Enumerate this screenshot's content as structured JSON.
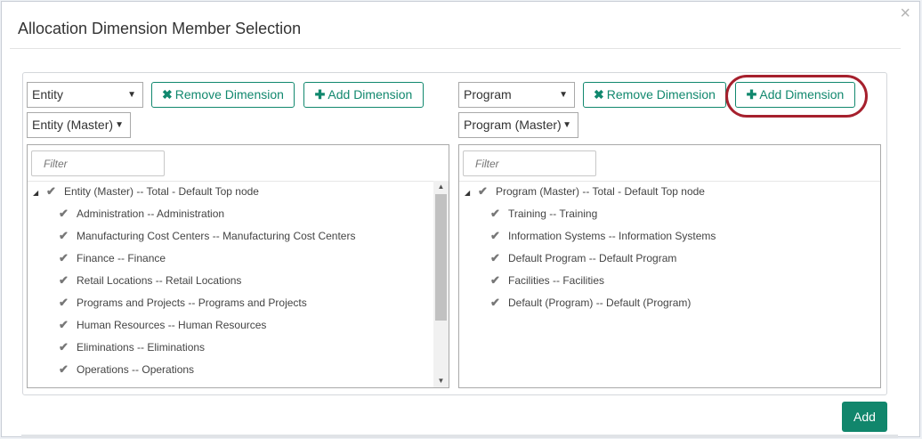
{
  "dialog": {
    "title": "Allocation Dimension Member Selection",
    "close_glyph": "×",
    "add_label": "Add"
  },
  "left": {
    "dimension_select": "Entity",
    "hierarchy_select": "Entity (Master)",
    "remove_label": "Remove Dimension",
    "add_label": "Add Dimension",
    "filter_placeholder": "Filter",
    "root": "Entity (Master) -- Total - Default Top node",
    "items": [
      "Administration -- Administration",
      "Manufacturing Cost Centers -- Manufacturing Cost Centers",
      "Finance -- Finance",
      "Retail Locations -- Retail Locations",
      "Programs and Projects -- Programs and Projects",
      "Human Resources -- Human Resources",
      "Eliminations -- Eliminations",
      "Operations -- Operations"
    ]
  },
  "right": {
    "dimension_select": "Program",
    "hierarchy_select": "Program (Master)",
    "remove_label": "Remove Dimension",
    "add_label": "Add Dimension",
    "filter_placeholder": "Filter",
    "root": "Program (Master) -- Total - Default Top node",
    "items": [
      "Training -- Training",
      "Information Systems -- Information Systems",
      "Default Program -- Default Program",
      "Facilities -- Facilities",
      "Default (Program) -- Default (Program)"
    ]
  },
  "colors": {
    "accent": "#11866c",
    "highlight_ring": "#a6202d",
    "checkmark": "#777777"
  },
  "icons": {
    "remove": "times-icon",
    "add": "plus-icon",
    "expand": "collapse-triangle-icon",
    "check": "check-icon"
  }
}
